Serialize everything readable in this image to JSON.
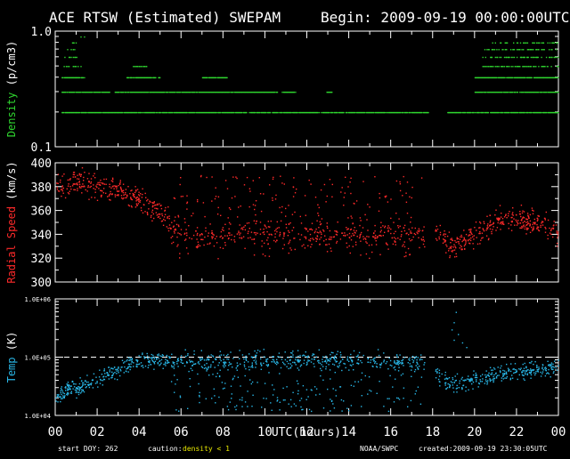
{
  "header": {
    "title": "ACE RTSW (Estimated) SWEPAM",
    "begin": "Begin: 2009-09-19 00:00:00UTC"
  },
  "footer": {
    "start_doy": "start DOY: 262",
    "caution_label": "caution:",
    "caution_value": "density < 1",
    "source": "NOAA/SWPC",
    "created": "created:2009-09-19 23:30:05UTC"
  },
  "colors": {
    "density": "#2fd52f",
    "speed": "#ff2a2a",
    "temp": "#29b6e6",
    "caution": "#e8e800",
    "axes": "#ffffff"
  },
  "chart_data": [
    {
      "type": "scatter",
      "ylabel": "Density (p/cm3)",
      "yscale": "log",
      "ylim": [
        0.1,
        1.0
      ],
      "yticks": [
        "1.0",
        "0.1"
      ],
      "x_ticks": [
        "00",
        "02",
        "04",
        "06",
        "08",
        "10",
        "12",
        "14",
        "16",
        "18",
        "20",
        "22",
        "00"
      ],
      "xlim": [
        0,
        24
      ],
      "segments": [
        {
          "x": [
            0.3,
            2.8
          ],
          "y": 0.2
        },
        {
          "x": [
            0.3,
            2.6
          ],
          "y": 0.3
        },
        {
          "x": [
            0.3,
            1.4
          ],
          "y": 0.4
        },
        {
          "x": [
            0.4,
            1.3
          ],
          "y": 0.5
        },
        {
          "x": [
            0.4,
            1.2
          ],
          "y": 0.6
        },
        {
          "x": [
            0.5,
            1.0
          ],
          "y": 0.7
        },
        {
          "x": [
            0.7,
            1.0
          ],
          "y": 0.8
        },
        {
          "x": [
            1.2,
            1.4
          ],
          "y": 0.9
        },
        {
          "x": [
            2.8,
            5.0
          ],
          "y": 0.2
        },
        {
          "x": [
            2.8,
            5.2
          ],
          "y": 0.3
        },
        {
          "x": [
            3.4,
            5.0
          ],
          "y": 0.4
        },
        {
          "x": [
            3.7,
            4.5
          ],
          "y": 0.5
        },
        {
          "x": [
            5.0,
            10.6
          ],
          "y": 0.2
        },
        {
          "x": [
            5.0,
            10.6
          ],
          "y": 0.3
        },
        {
          "x": [
            7.0,
            8.2
          ],
          "y": 0.4
        },
        {
          "x": [
            10.6,
            17.8
          ],
          "y": 0.2
        },
        {
          "x": [
            10.8,
            11.5
          ],
          "y": 0.3
        },
        {
          "x": [
            12.9,
            13.2
          ],
          "y": 0.3
        },
        {
          "x": [
            18.7,
            24.0
          ],
          "y": 0.2
        },
        {
          "x": [
            20.0,
            24.0
          ],
          "y": 0.3
        },
        {
          "x": [
            20.0,
            24.0
          ],
          "y": 0.4
        },
        {
          "x": [
            20.3,
            24.0
          ],
          "y": 0.5
        },
        {
          "x": [
            20.3,
            24.0
          ],
          "y": 0.6
        },
        {
          "x": [
            20.4,
            24.0
          ],
          "y": 0.7
        },
        {
          "x": [
            20.8,
            24.0
          ],
          "y": 0.8
        },
        {
          "x": [
            20.2,
            24.0
          ],
          "y": 0.1
        }
      ]
    },
    {
      "type": "scatter",
      "ylabel": "Radial Speed (km/s)",
      "ylim": [
        300,
        400
      ],
      "yticks": [
        300,
        320,
        340,
        360,
        380,
        400
      ],
      "x_ticks": [
        "00",
        "02",
        "04",
        "06",
        "08",
        "10",
        "12",
        "14",
        "16",
        "18",
        "20",
        "22",
        "00"
      ],
      "xlim": [
        0,
        24
      ],
      "trend": [
        [
          0,
          383
        ],
        [
          1,
          385
        ],
        [
          2,
          380
        ],
        [
          3,
          377
        ],
        [
          4,
          368
        ],
        [
          5,
          360
        ],
        [
          5.7,
          345
        ],
        [
          6.5,
          338
        ],
        [
          7.5,
          338
        ],
        [
          8.5,
          340
        ],
        [
          10,
          342
        ],
        [
          12,
          340
        ],
        [
          14,
          340
        ],
        [
          16,
          340
        ],
        [
          17.5,
          340
        ],
        [
          18,
          345
        ],
        [
          19,
          330
        ],
        [
          20,
          340
        ],
        [
          21,
          352
        ],
        [
          22,
          353
        ],
        [
          23,
          350
        ],
        [
          24,
          342
        ]
      ],
      "scatter_band": {
        "hours": [
          5.5,
          17.5
        ],
        "range": [
          320,
          390
        ]
      }
    },
    {
      "type": "scatter",
      "ylabel": "Temp (K)",
      "yscale": "log",
      "ylim": [
        10000,
        1000000
      ],
      "yticks": [
        "1.0E+06",
        "1.0E+05",
        "1.0E+04"
      ],
      "reference_line": 100000,
      "x_ticks": [
        "00",
        "02",
        "04",
        "06",
        "08",
        "10",
        "12",
        "14",
        "16",
        "18",
        "20",
        "22",
        "00"
      ],
      "xlim": [
        0,
        24
      ],
      "xlabel": "UTC(hours)",
      "trend": [
        [
          0,
          22000
        ],
        [
          1,
          30000
        ],
        [
          2,
          40000
        ],
        [
          3,
          65000
        ],
        [
          4,
          85000
        ],
        [
          5,
          90000
        ],
        [
          6,
          80000
        ],
        [
          8,
          85000
        ],
        [
          10,
          85000
        ],
        [
          12,
          90000
        ],
        [
          14,
          90000
        ],
        [
          16,
          85000
        ],
        [
          17.5,
          80000
        ],
        [
          18.5,
          40000
        ],
        [
          19.5,
          35000
        ],
        [
          20.5,
          45000
        ],
        [
          21.5,
          55000
        ],
        [
          22.5,
          60000
        ],
        [
          24,
          70000
        ]
      ],
      "scatter_band": {
        "hours": [
          5.5,
          17.5
        ],
        "range": [
          12000,
          140000
        ]
      }
    }
  ]
}
